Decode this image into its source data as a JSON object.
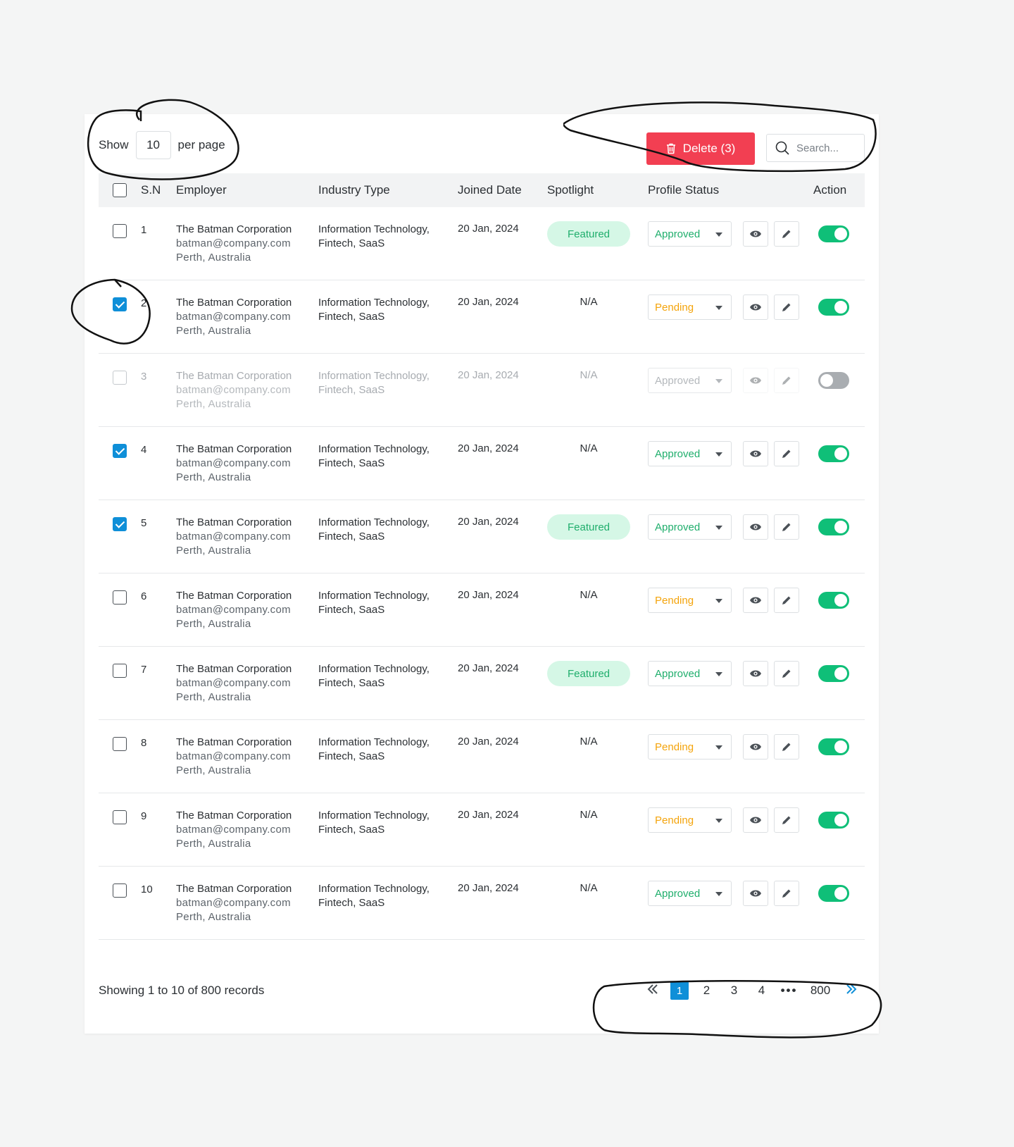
{
  "toolbar": {
    "show_label": "Show",
    "per_page_value": "10",
    "per_page_label": "per page",
    "delete_label": "Delete (3)",
    "search_placeholder": "Search..."
  },
  "columns": [
    "S.N",
    "Employer",
    "Industry Type",
    "Joined Date",
    "Spotlight",
    "Profile Status",
    "Action"
  ],
  "rows": [
    {
      "sn": "1",
      "checked": false,
      "disabled": false,
      "name": "The Batman Corporation",
      "email": "batman@company.com",
      "location": "Perth, Australia",
      "industry_1": "Information Technology,",
      "industry_2": "Fintech, SaaS",
      "date": "20 Jan, 2024",
      "spotlight": "Featured",
      "status": "Approved",
      "active": true
    },
    {
      "sn": "2",
      "checked": true,
      "disabled": false,
      "name": "The Batman Corporation",
      "email": "batman@company.com",
      "location": "Perth, Australia",
      "industry_1": "Information Technology,",
      "industry_2": "Fintech, SaaS",
      "date": "20 Jan, 2024",
      "spotlight": "N/A",
      "status": "Pending",
      "active": true
    },
    {
      "sn": "3",
      "checked": false,
      "disabled": true,
      "name": "The Batman Corporation",
      "email": "batman@company.com",
      "location": "Perth, Australia",
      "industry_1": "Information Technology,",
      "industry_2": "Fintech, SaaS",
      "date": "20 Jan, 2024",
      "spotlight": "N/A",
      "status": "Approved",
      "active": false
    },
    {
      "sn": "4",
      "checked": true,
      "disabled": false,
      "name": "The Batman Corporation",
      "email": "batman@company.com",
      "location": "Perth, Australia",
      "industry_1": "Information Technology,",
      "industry_2": "Fintech, SaaS",
      "date": "20 Jan, 2024",
      "spotlight": "N/A",
      "status": "Approved",
      "active": true
    },
    {
      "sn": "5",
      "checked": true,
      "disabled": false,
      "name": "The Batman Corporation",
      "email": "batman@company.com",
      "location": "Perth, Australia",
      "industry_1": "Information Technology,",
      "industry_2": "Fintech, SaaS",
      "date": "20 Jan, 2024",
      "spotlight": "Featured",
      "status": "Approved",
      "active": true
    },
    {
      "sn": "6",
      "checked": false,
      "disabled": false,
      "name": "The Batman Corporation",
      "email": "batman@company.com",
      "location": "Perth, Australia",
      "industry_1": "Information Technology,",
      "industry_2": "Fintech, SaaS",
      "date": "20 Jan, 2024",
      "spotlight": "N/A",
      "status": "Pending",
      "active": true
    },
    {
      "sn": "7",
      "checked": false,
      "disabled": false,
      "name": "The Batman Corporation",
      "email": "batman@company.com",
      "location": "Perth, Australia",
      "industry_1": "Information Technology,",
      "industry_2": "Fintech, SaaS",
      "date": "20 Jan, 2024",
      "spotlight": "Featured",
      "status": "Approved",
      "active": true
    },
    {
      "sn": "8",
      "checked": false,
      "disabled": false,
      "name": "The Batman Corporation",
      "email": "batman@company.com",
      "location": "Perth, Australia",
      "industry_1": "Information Technology,",
      "industry_2": "Fintech, SaaS",
      "date": "20 Jan, 2024",
      "spotlight": "N/A",
      "status": "Pending",
      "active": true
    },
    {
      "sn": "9",
      "checked": false,
      "disabled": false,
      "name": "The Batman Corporation",
      "email": "batman@company.com",
      "location": "Perth, Australia",
      "industry_1": "Information Technology,",
      "industry_2": "Fintech, SaaS",
      "date": "20 Jan, 2024",
      "spotlight": "N/A",
      "status": "Pending",
      "active": true
    },
    {
      "sn": "10",
      "checked": false,
      "disabled": false,
      "name": "The Batman Corporation",
      "email": "batman@company.com",
      "location": "Perth, Australia",
      "industry_1": "Information Technology,",
      "industry_2": "Fintech, SaaS",
      "date": "20 Jan, 2024",
      "spotlight": "N/A",
      "status": "Approved",
      "active": true
    }
  ],
  "footer": {
    "summary": "Showing 1 to 10 of 800 records",
    "pages": [
      "1",
      "2",
      "3",
      "4"
    ],
    "ellipsis": "•••",
    "last_page": "800",
    "current_page": "1"
  },
  "icons": {
    "delete": "trash-icon",
    "search": "search-icon",
    "view": "eye-icon",
    "edit": "pencil-icon",
    "first": "double-chevron-left-icon",
    "next": "double-chevron-right-icon"
  },
  "colors": {
    "danger": "#f23f52",
    "primary": "#0f8fd8",
    "success": "#1fae6c",
    "warning": "#f4a40c",
    "toggle_on": "#0fbf78",
    "featured_bg": "#d5f7e6"
  }
}
